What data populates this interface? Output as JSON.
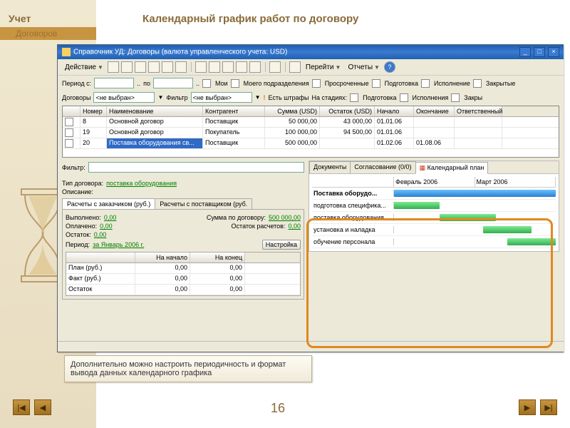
{
  "slide": {
    "title": "Календарный график работ по договору",
    "side_title": "Учет",
    "side_title2": "Договоров",
    "page_number": "16",
    "note": "Дополнительно можно настроить периодичность и формат вывода данных календарного графика"
  },
  "window": {
    "title": "Справочник УД: Договоры (валюта управленческого учета: USD)",
    "menu": {
      "action": "Действие",
      "goto": "Перейти",
      "reports": "Отчеты"
    },
    "filters": {
      "period_label": "Период с:",
      "period_to": "по",
      "mine": "Мои",
      "my_dept": "Моего подразделения",
      "overdue": "Просроченные",
      "prep": "Подготовка",
      "exec": "Исполнение",
      "closed": "Закрытые",
      "contracts": "Договоры",
      "not_selected": "<не выбран>",
      "filter": "Фильтр",
      "has_fines": "Есть штрафы",
      "on_stage": "На стадиях:",
      "prep2": "Подготовка",
      "exec2": "Исполнения",
      "closed2": "Закры"
    },
    "grid": {
      "headers": {
        "num": "Номер",
        "name": "Наименование",
        "contr": "Контрагент",
        "sum": "Сумма (USD)",
        "rest": "Остаток (USD)",
        "start": "Начало",
        "end": "Окончание",
        "resp": "Ответственный"
      },
      "rows": [
        {
          "num": "8",
          "name": "Основной договор",
          "contr": "Поставщик",
          "sum": "50 000,00",
          "rest": "43 000,00",
          "start": "01.01.06",
          "end": "",
          "resp": ""
        },
        {
          "num": "19",
          "name": "Основной договор",
          "contr": "Покупатель",
          "sum": "100 000,00",
          "rest": "94 500,00",
          "start": "01.01.06",
          "end": "",
          "resp": ""
        },
        {
          "num": "20",
          "name": "Поставка оборудования св...",
          "contr": "Поставщик",
          "sum": "500 000,00",
          "rest": "",
          "start": "01.02.06",
          "end": "01.08.06",
          "resp": ""
        }
      ]
    },
    "lower_left": {
      "filter": "Фильтр:",
      "type_label": "Тип договора:",
      "type_value": "поставка оборудования",
      "desc": "Описание:",
      "tab1": "Расчеты с заказчиком (руб.)",
      "tab2": "Расчеты с поставщиком (руб.",
      "done": "Выполнено:",
      "done_v": "0,00",
      "sum_c": "Сумма по договору:",
      "sum_v": "500 000,00",
      "paid": "Оплачено:",
      "paid_v": "0,00",
      "rest_c": "Остаток расчетов:",
      "rest_v": "0,00",
      "rest": "Остаток:",
      "rest2_v": "0,00",
      "period": "Период:",
      "period_v": "за Январь 2006 г.",
      "settings": "Настройка",
      "mini_head": {
        "h0": "",
        "h1": "На начало",
        "h2": "На конец"
      },
      "mini_rows": [
        {
          "l": "План (руб.)",
          "a": "0,00",
          "b": "0,00"
        },
        {
          "l": "Факт (руб.)",
          "a": "0,00",
          "b": "0,00"
        },
        {
          "l": "Остаток",
          "a": "0,00",
          "b": "0,00"
        }
      ]
    },
    "right": {
      "tabs": {
        "docs": "Документы",
        "agree": "Согласование (0/0)",
        "plan": "Календарный план"
      },
      "gantt": {
        "months": {
          "m1": "Февраль 2006",
          "m2": "Март 2006"
        },
        "rows": [
          {
            "label": "Поставка оборудо...",
            "bold": true
          },
          {
            "label": "подготовка специфика..."
          },
          {
            "label": "поставка оборудования"
          },
          {
            "label": "установка и наладка"
          },
          {
            "label": "обучение персонала"
          }
        ]
      }
    }
  }
}
